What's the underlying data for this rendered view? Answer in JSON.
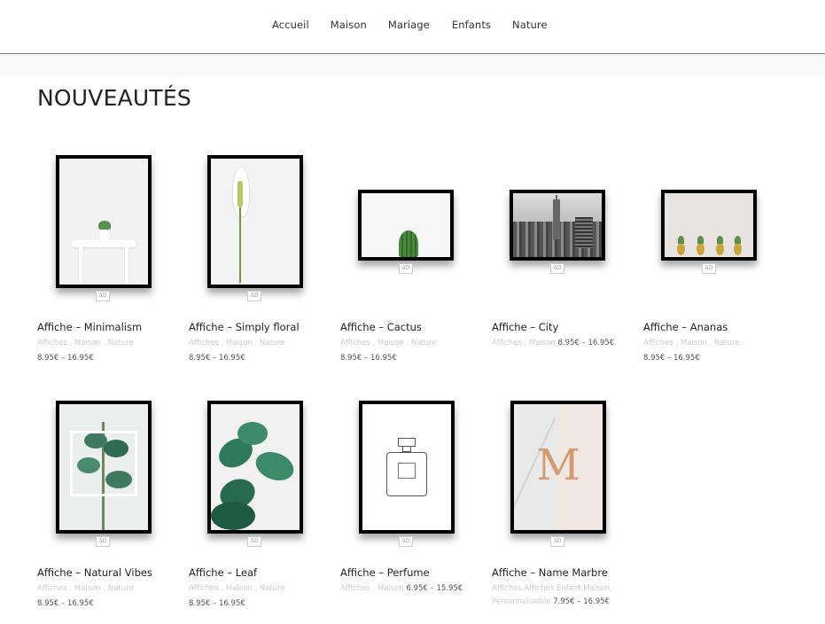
{
  "nav": {
    "items": [
      "Accueil",
      "Maison",
      "Mariage",
      "Enfants",
      "Nature"
    ]
  },
  "page_title": "NOUVEAUTÉS",
  "badge": "AD",
  "products": [
    {
      "title": "Affiche – Minimalism",
      "cats": "Affiches   ,   Maison   ,   Nature",
      "price": "8.95€ – 16.95€"
    },
    {
      "title": "Affiche – Simply floral",
      "cats": "Affiches   ,   Maison   ,   Nature",
      "price": "8.95€ – 16.95€"
    },
    {
      "title": "Affiche – Cactus",
      "cats": "Affiches   ,   Maison   ,   Nature",
      "price": "8.95€ – 16.95€"
    },
    {
      "title": "Affiche – City",
      "cats": "Affiches , Maison",
      "price": "8.95€ – 16.95€"
    },
    {
      "title": "Affiche – Ananas",
      "cats": "Affiches   ,   Maison   ,   Nature",
      "price": "8.95€ – 16.95€"
    },
    {
      "title": "Affiche – Natural Vibes",
      "cats": "Affiches   ,   Maison   ,   Nature",
      "price": "8.95€ – 16.95€"
    },
    {
      "title": "Affiche – Leaf",
      "cats": "Affiches   ,   Maison   ,   Nature",
      "price": "8.95€ – 16.95€"
    },
    {
      "title": "Affiche – Perfume",
      "cats": "Affiches , Maison",
      "price": "6.95€ – 15.95€"
    },
    {
      "title": "Affiche – Name Marbre",
      "cats": "Affiches,Affiches Enfant,Maison,",
      "cats2": "Personnalisable",
      "price": "7.95€ – 16.95€"
    }
  ]
}
